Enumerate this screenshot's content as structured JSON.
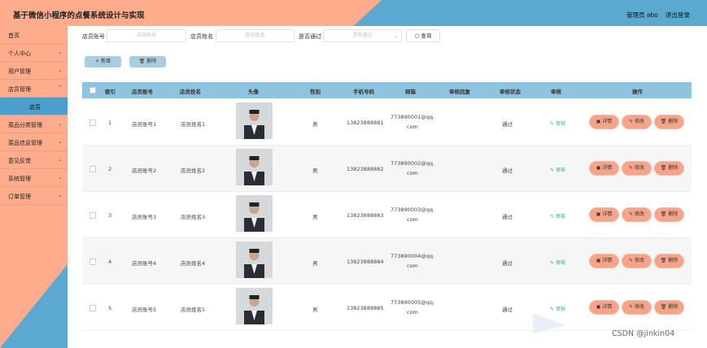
{
  "header": {
    "title": "基于微信小程序的点餐系统设计与实现",
    "user": "管理员 abo",
    "logout": "退出登录"
  },
  "sidebar": {
    "items": [
      {
        "label": "首页",
        "chevron": ""
      },
      {
        "label": "个人中心",
        "chevron": "⌄"
      },
      {
        "label": "用户管理",
        "chevron": "⌄"
      },
      {
        "label": "店员管理",
        "chevron": "⌃"
      },
      {
        "label": "店员",
        "chevron": ""
      },
      {
        "label": "菜品分类管理",
        "chevron": "⌄"
      },
      {
        "label": "菜品信息管理",
        "chevron": "⌄"
      },
      {
        "label": "意见反馈",
        "chevron": "⌄"
      },
      {
        "label": "系统管理",
        "chevron": "⌄"
      },
      {
        "label": "订单管理",
        "chevron": "⌄"
      }
    ]
  },
  "search": {
    "account_label": "店员账号",
    "account_placeholder": "店员账号",
    "name_label": "店员姓名",
    "name_placeholder": "店员姓名",
    "passed_label": "是否通过",
    "passed_placeholder": "是否通过",
    "search_button": "查询"
  },
  "toolbar": {
    "add": "新增",
    "delete": "删除"
  },
  "table": {
    "headers": [
      "索引",
      "店员账号",
      "店员姓名",
      "头像",
      "性别",
      "手机号码",
      "邮箱",
      "审核回复",
      "审核状态",
      "审核",
      "操作"
    ],
    "rows": [
      {
        "index": "1",
        "account": "店员账号1",
        "name": "店员姓名1",
        "gender": "男",
        "phone": "13823888881",
        "email_a": "773890001@qq.",
        "email_b": "com",
        "status": "通过",
        "audit": "审核"
      },
      {
        "index": "2",
        "account": "店员账号2",
        "name": "店员姓名2",
        "gender": "男",
        "phone": "13823888882",
        "email_a": "773890002@qq.",
        "email_b": "com",
        "status": "通过",
        "audit": "审核"
      },
      {
        "index": "3",
        "account": "店员账号3",
        "name": "店员姓名3",
        "gender": "男",
        "phone": "13823888883",
        "email_a": "773890003@qq.",
        "email_b": "com",
        "status": "通过",
        "audit": "审核"
      },
      {
        "index": "4",
        "account": "店员账号4",
        "name": "店员姓名4",
        "gender": "男",
        "phone": "13823888884",
        "email_a": "773890004@qq.",
        "email_b": "com",
        "status": "通过",
        "audit": "审核"
      },
      {
        "index": "5",
        "account": "店员账号5",
        "name": "店员姓名5",
        "gender": "男",
        "phone": "13823888885",
        "email_a": "773890005@qq.",
        "email_b": "com",
        "status": "通过",
        "audit": "审核"
      }
    ],
    "ops": {
      "detail": "详情",
      "edit": "修改",
      "delete": "删除"
    }
  },
  "watermark": "CSDN @jinkin04",
  "colors": {
    "salmon": "#ffac8c",
    "blue": "#5ba8d1",
    "header_row": "#8ec4e0",
    "op_button": "#f5a48a",
    "audit_green": "#36b36b"
  }
}
